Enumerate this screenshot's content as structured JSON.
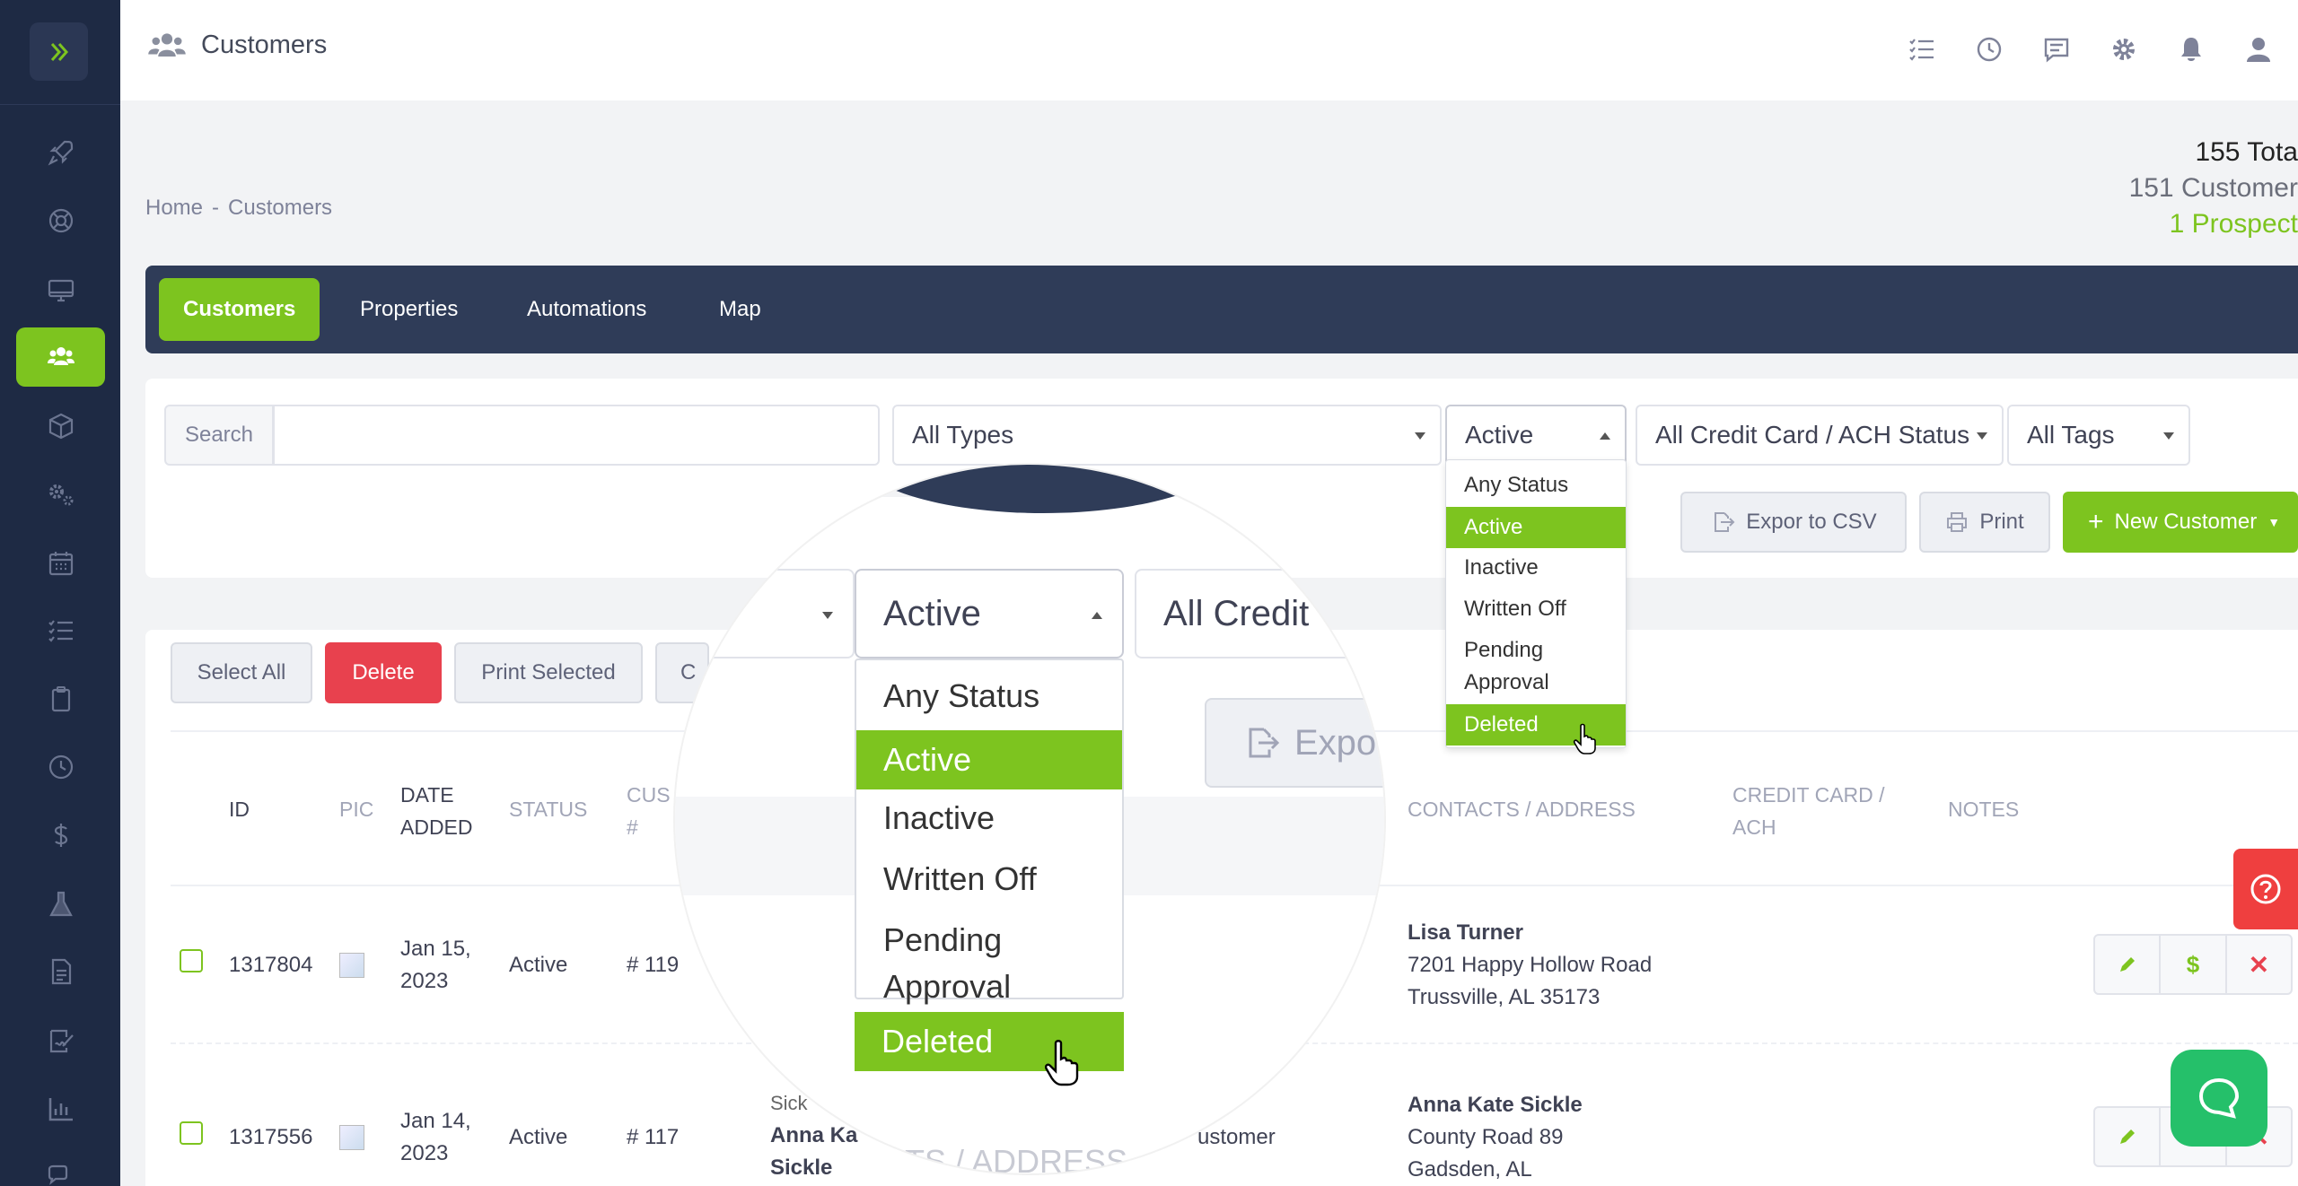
{
  "app": {
    "title": "Customers"
  },
  "breadcrumb": {
    "home": "Home",
    "separator": "-",
    "current": "Customers"
  },
  "counts": {
    "total": "155 Tota",
    "customers": "151 Customer",
    "prospects": "1 Prospect"
  },
  "tabs": [
    {
      "label": "Customers",
      "active": true
    },
    {
      "label": "Properties",
      "active": false
    },
    {
      "label": "Automations",
      "active": false
    },
    {
      "label": "Map",
      "active": false
    }
  ],
  "filters": {
    "search_label": "Search",
    "search_value": "",
    "types": "All Types",
    "status": "Active",
    "payment_status": "All Credit Card / ACH Status",
    "tags": "All Tags"
  },
  "status_menu": {
    "options": [
      "Any Status",
      "Active",
      "Inactive",
      "Written Off",
      "Pending Approval",
      "Deleted"
    ],
    "selected": "Active",
    "hovered": "Deleted"
  },
  "toolbar": {
    "export_csv": "Expor  to CSV",
    "print": "Print",
    "new_customer": "New Customer"
  },
  "bulk": {
    "select_all": "Select All",
    "delete": "Delete",
    "print_selected": "Print Selected",
    "truncated": "C"
  },
  "table": {
    "headers": {
      "id": "ID",
      "pic": "PIC",
      "date_added_1": "DATE",
      "date_added_2": "ADDED",
      "status": "STATUS",
      "cust_1": "CUS",
      "cust_2": "#",
      "contacts": "CONTACTS / ADDRESS",
      "cc_1": "CREDIT CARD /",
      "cc_2": "ACH",
      "notes": "NOTES"
    },
    "rows": [
      {
        "id": "1317804",
        "date_1": "Jan 15,",
        "date_2": "2023",
        "status": "Active",
        "cust": "# 119",
        "contact_name": "Lisa Turner",
        "address_1": "7201 Happy Hollow Road",
        "address_2": "Trussville, AL 35173"
      },
      {
        "id": "1317556",
        "date_1": "Jan 14,",
        "date_2": "2023",
        "status": "Active",
        "cust": "# 117",
        "type": "ustomer",
        "name_small": "Sick",
        "name_1": "Anna Ka",
        "name_2": "Sickle",
        "contact_name": "Anna Kate Sickle",
        "address_1": "County Road 89",
        "address_2": "Gadsden, AL"
      }
    ]
  },
  "magnifier": {
    "status": "Active",
    "payment": "All Credit",
    "export": "Expor",
    "faint_header": "CTS / ADDRESS"
  },
  "colors": {
    "accent": "#7dc41f",
    "sidebar": "#1e2a44",
    "tabbar": "#2f3c58",
    "danger": "#e8414e",
    "chat": "#25c06a"
  }
}
